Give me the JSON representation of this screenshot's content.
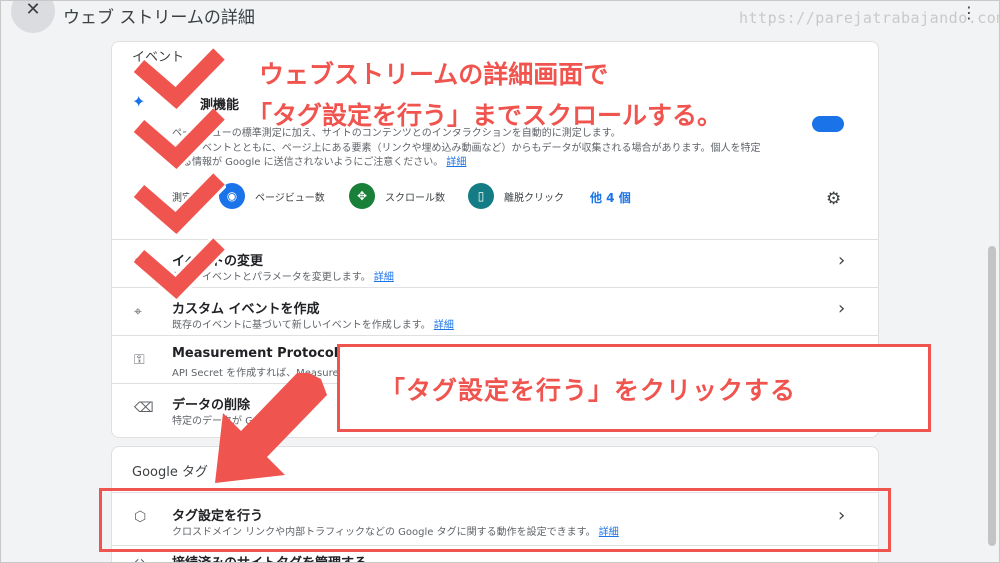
{
  "header": {
    "close_glyph": "✕",
    "title": "ウェブ ストリームの詳細",
    "url": "https://parejatrabajando.com/",
    "menu_glyph": "⋮"
  },
  "events_card": {
    "section_label": "イベント",
    "enhanced": {
      "title_fragment": "測機能",
      "desc_line1": "ページビューの標準測定に加え、サイトのコンテンツとのインタラクションを自動的に測定します。",
      "desc_line2": "関連イベントとともに、ページ上にある要素（リンクや埋め込み動画など）からもデータが収集される場合があります。個人を特定",
      "desc_line3": "する情報が Google に送信されないようにご注意ください。",
      "link": "詳細",
      "measuring_label": "測定",
      "features": [
        {
          "label": "ページビュー数",
          "icon": "eye-icon",
          "glyph": "◉"
        },
        {
          "label": "スクロール数",
          "icon": "crosshair-icon",
          "glyph": "✥"
        },
        {
          "label": "離脱クリック",
          "icon": "mouse-icon",
          "glyph": "▯"
        }
      ],
      "more": "他 4 個",
      "gear_glyph": "⚙"
    },
    "rows": [
      {
        "icon": "edit-event-icon",
        "glyph": "✎",
        "title": "イベントの変更",
        "desc": "既存のイベントとパラメータを変更します。",
        "link": "詳細"
      },
      {
        "icon": "cursor-sparkle-icon",
        "glyph": "⌖",
        "title": "カスタム イベントを作成",
        "desc": "既存のイベントに基づいて新しいイベントを作成します。",
        "link": "詳細"
      },
      {
        "icon": "key-icon",
        "glyph": "⚿",
        "title": "Measurement Protocol API se",
        "desc": "API Secret を作成すれば、Measure",
        "link": ""
      },
      {
        "icon": "eraser-icon",
        "glyph": "⌫",
        "title": "データの削除",
        "desc": "特定のデータが Google",
        "link": ""
      }
    ],
    "chevron_glyph": "›"
  },
  "google_tag_card": {
    "section_label": "Google タグ",
    "rows": [
      {
        "icon": "tag-icon",
        "glyph": "⬡",
        "title": "タグ設定を行う",
        "desc": "クロスドメイン リンクや内部トラフィックなどの Google タグに関する動作を設定できます。",
        "link": "詳細"
      },
      {
        "icon": "site-tag-icon",
        "glyph": "‹›",
        "title": "接続済みのサイトタグを管理する",
        "desc": "",
        "link": ""
      }
    ]
  },
  "annotations": {
    "headline_line1": "ウェブストリームの詳細画面で",
    "headline_line2": "「タグ設定を行う」までスクロールする。",
    "callout": "「タグ設定を行う」をクリックする",
    "accent_color": "#f0544f"
  }
}
